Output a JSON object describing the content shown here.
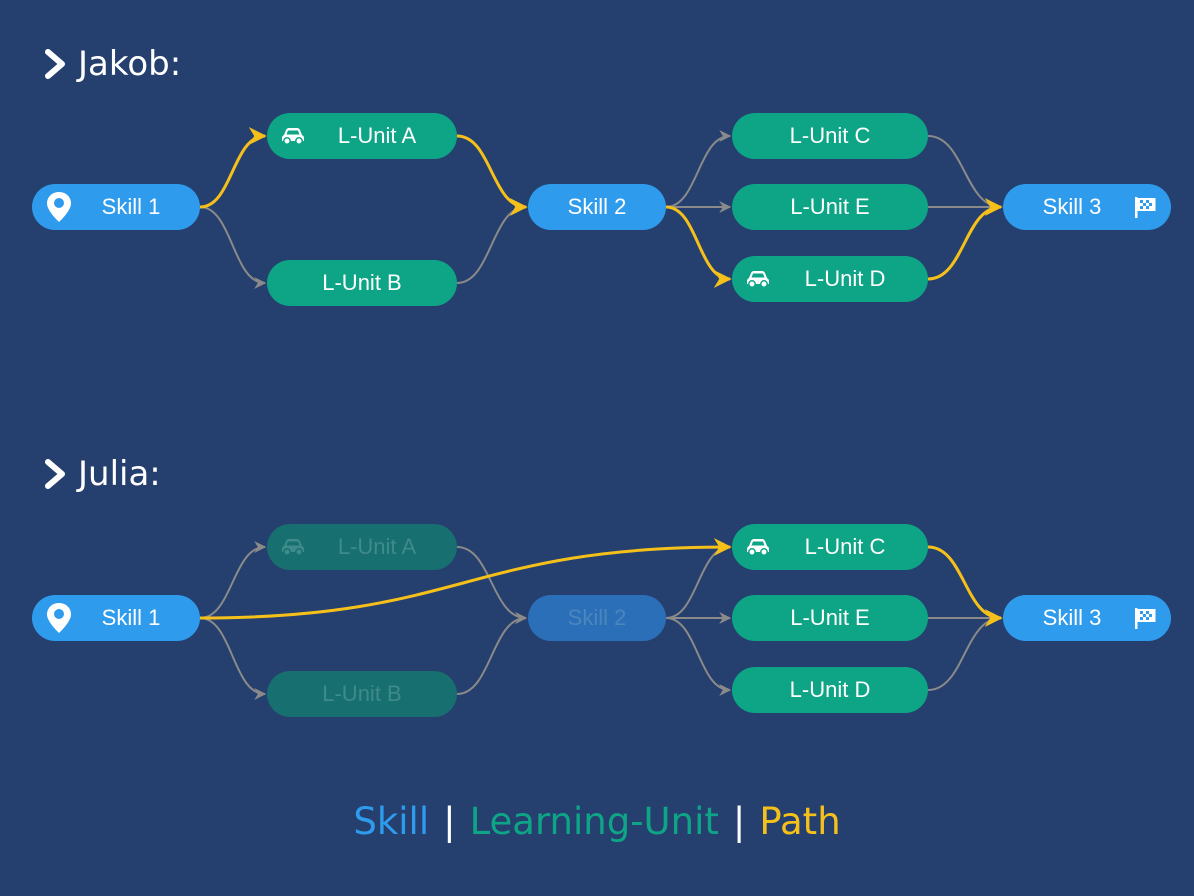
{
  "colors": {
    "background": "#253f6e",
    "skill": "#2f9bed",
    "learning_unit": "#0ea586",
    "path": "#f6c01a",
    "edge": "#8a8a8a"
  },
  "sections": [
    {
      "title": "Jakob:",
      "nodes": [
        {
          "id": "s1",
          "label": "Skill 1",
          "type": "skill",
          "icon": "map-pin-icon",
          "icon_side": "left"
        },
        {
          "id": "a",
          "label": "L-Unit A",
          "type": "lu",
          "icon": "car-icon",
          "icon_side": "left"
        },
        {
          "id": "b",
          "label": "L-Unit B",
          "type": "lu"
        },
        {
          "id": "s2",
          "label": "Skill 2",
          "type": "skill"
        },
        {
          "id": "c",
          "label": "L-Unit C",
          "type": "lu"
        },
        {
          "id": "e",
          "label": "L-Unit E",
          "type": "lu"
        },
        {
          "id": "d",
          "label": "L-Unit D",
          "type": "lu",
          "icon": "car-icon",
          "icon_side": "left"
        },
        {
          "id": "s3",
          "label": "Skill 3",
          "type": "skill",
          "icon": "checkered-flag-icon",
          "icon_side": "right"
        }
      ],
      "edges": [
        {
          "from": "s1",
          "to": "a",
          "path": true
        },
        {
          "from": "s1",
          "to": "b",
          "path": false
        },
        {
          "from": "a",
          "to": "s2",
          "path": true
        },
        {
          "from": "b",
          "to": "s2",
          "path": false
        },
        {
          "from": "s2",
          "to": "c",
          "path": false
        },
        {
          "from": "s2",
          "to": "e",
          "path": false
        },
        {
          "from": "s2",
          "to": "d",
          "path": true
        },
        {
          "from": "c",
          "to": "s3",
          "path": false
        },
        {
          "from": "e",
          "to": "s3",
          "path": false
        },
        {
          "from": "d",
          "to": "s3",
          "path": true
        }
      ]
    },
    {
      "title": "Julia:",
      "nodes": [
        {
          "id": "s1",
          "label": "Skill 1",
          "type": "skill",
          "icon": "map-pin-icon",
          "icon_side": "left"
        },
        {
          "id": "a",
          "label": "L-Unit A",
          "type": "lu",
          "icon": "car-icon",
          "icon_side": "left",
          "dimmed": true
        },
        {
          "id": "b",
          "label": "L-Unit B",
          "type": "lu",
          "dimmed": true
        },
        {
          "id": "s2",
          "label": "Skill 2",
          "type": "skill",
          "dimmed": true
        },
        {
          "id": "c",
          "label": "L-Unit C",
          "type": "lu",
          "icon": "car-icon",
          "icon_side": "left"
        },
        {
          "id": "e",
          "label": "L-Unit E",
          "type": "lu"
        },
        {
          "id": "d",
          "label": "L-Unit D",
          "type": "lu"
        },
        {
          "id": "s3",
          "label": "Skill 3",
          "type": "skill",
          "icon": "checkered-flag-icon",
          "icon_side": "right"
        }
      ],
      "edges": [
        {
          "from": "s1",
          "to": "a",
          "path": false
        },
        {
          "from": "s1",
          "to": "b",
          "path": false
        },
        {
          "from": "a",
          "to": "s2",
          "path": false
        },
        {
          "from": "b",
          "to": "s2",
          "path": false
        },
        {
          "from": "s2",
          "to": "c",
          "path": false
        },
        {
          "from": "s2",
          "to": "e",
          "path": false
        },
        {
          "from": "s2",
          "to": "d",
          "path": false
        },
        {
          "from": "c",
          "to": "s3",
          "path": true
        },
        {
          "from": "e",
          "to": "s3",
          "path": false
        },
        {
          "from": "d",
          "to": "s3",
          "path": false
        },
        {
          "from": "s1",
          "to": "c",
          "path": true
        }
      ]
    }
  ],
  "legend": {
    "skill": "Skill",
    "separator": "|",
    "learning_unit": "Learning-Unit",
    "path": "Path"
  }
}
